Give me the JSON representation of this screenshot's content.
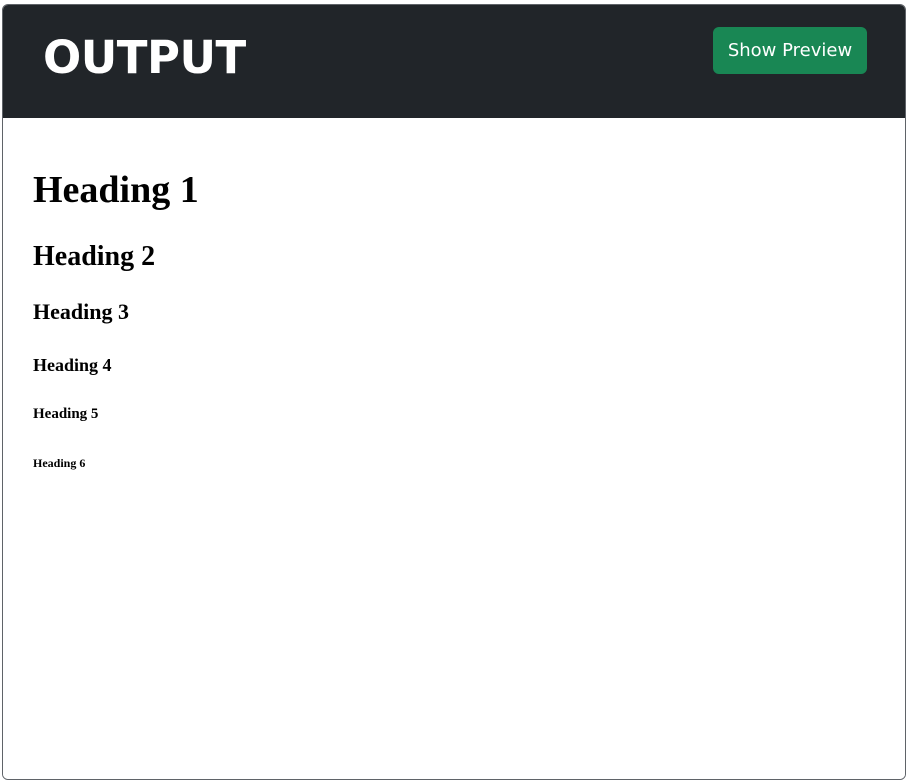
{
  "header": {
    "title": "OUTPUT",
    "preview_button_label": "Show Preview",
    "background_color": "#212529",
    "button_color": "#198754"
  },
  "preview": {
    "headings": [
      "Heading 1",
      "Heading 2",
      "Heading 3",
      "Heading 4",
      "Heading 5",
      "Heading 6"
    ]
  }
}
